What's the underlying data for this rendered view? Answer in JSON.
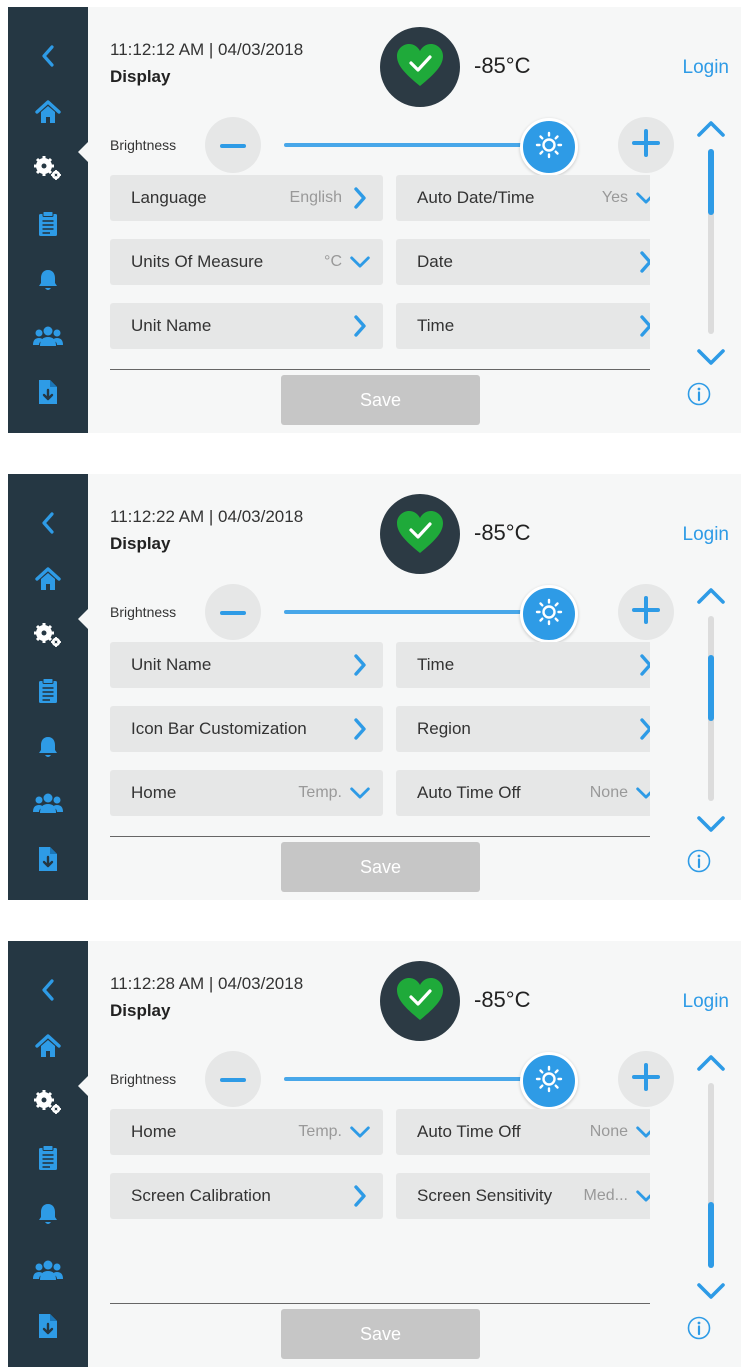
{
  "colors": {
    "accent": "#2e9be6",
    "sidebar": "#253743",
    "ok_green": "#1faa3a",
    "button_bg": "#e6e7e7",
    "save_disabled": "#c6c6c6"
  },
  "screens": [
    {
      "datetime": "11:12:12 AM | 04/03/2018",
      "title": "Display",
      "temperature": "-85°C",
      "login": "Login",
      "brightness_label": "Brightness",
      "brightness_level": 0.97,
      "scroll_position": 0.0,
      "save_label": "Save",
      "rows": [
        {
          "left": {
            "label": "Language",
            "value": "English",
            "icon": "chevron-right-icon"
          },
          "right": {
            "label": "Auto Date/Time",
            "value": "Yes",
            "icon": "chevron-down-icon"
          }
        },
        {
          "left": {
            "label": "Units Of Measure",
            "value": "°C",
            "icon": "chevron-down-icon"
          },
          "right": {
            "label": "Date",
            "value": "",
            "icon": "chevron-right-icon"
          }
        },
        {
          "left": {
            "label": "Unit Name",
            "value": "",
            "icon": "chevron-right-icon"
          },
          "right": {
            "label": "Time",
            "value": "",
            "icon": "chevron-right-icon"
          }
        }
      ]
    },
    {
      "datetime": "11:12:22 AM | 04/03/2018",
      "title": "Display",
      "temperature": "-85°C",
      "login": "Login",
      "brightness_label": "Brightness",
      "brightness_level": 0.97,
      "scroll_position": 0.33,
      "save_label": "Save",
      "rows": [
        {
          "left": {
            "label": "Unit Name",
            "value": "",
            "icon": "chevron-right-icon"
          },
          "right": {
            "label": "Time",
            "value": "",
            "icon": "chevron-right-icon"
          }
        },
        {
          "left": {
            "label": "Icon Bar Customization",
            "value": "",
            "icon": "chevron-right-icon"
          },
          "right": {
            "label": "Region",
            "value": "",
            "icon": "chevron-right-icon"
          }
        },
        {
          "left": {
            "label": "Home",
            "value": "Temp.",
            "icon": "chevron-down-icon"
          },
          "right": {
            "label": "Auto Time Off",
            "value": "None",
            "icon": "chevron-down-icon"
          }
        }
      ]
    },
    {
      "datetime": "11:12:28 AM | 04/03/2018",
      "title": "Display",
      "temperature": "-85°C",
      "login": "Login",
      "brightness_label": "Brightness",
      "brightness_level": 0.97,
      "scroll_position": 1.0,
      "save_label": "Save",
      "rows": [
        {
          "left": {
            "label": "Home",
            "value": "Temp.",
            "icon": "chevron-down-icon"
          },
          "right": {
            "label": "Auto Time Off",
            "value": "None",
            "icon": "chevron-down-icon"
          }
        },
        {
          "left": {
            "label": "Screen Calibration",
            "value": "",
            "icon": "chevron-right-icon"
          },
          "right": {
            "label": "Screen Sensitivity",
            "value": "Med...",
            "icon": "chevron-down-icon"
          }
        }
      ]
    }
  ]
}
